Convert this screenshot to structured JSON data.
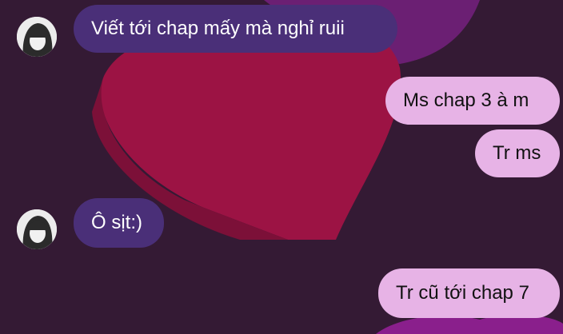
{
  "chat": {
    "background_colors": {
      "base": "#341a34",
      "heart_red": "#9c1344",
      "heart_purple": "#6b1f73"
    },
    "bubble_colors": {
      "incoming": "#4a2f78",
      "outgoing": "#e7b3e6"
    },
    "messages": [
      {
        "direction": "incoming",
        "text": "Viết tới chap mấy mà nghỉ ruii",
        "avatar_icon": "contact-avatar"
      },
      {
        "direction": "outgoing",
        "text": "Ms chap 3 à m"
      },
      {
        "direction": "outgoing",
        "text": "Tr ms"
      },
      {
        "direction": "incoming",
        "text": "Ô sịt:)",
        "avatar_icon": "contact-avatar"
      },
      {
        "direction": "outgoing",
        "text": "Tr cũ tới chap 7"
      }
    ]
  }
}
